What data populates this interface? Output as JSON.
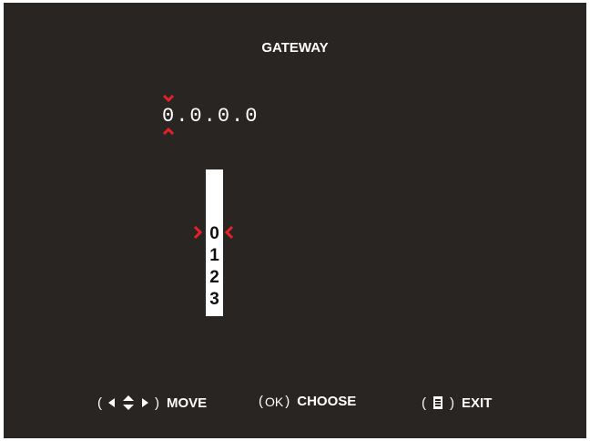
{
  "screen": {
    "title": "GATEWAY"
  },
  "ip_editor": {
    "octets": [
      "0",
      "0",
      "0",
      "0"
    ],
    "separator": ".",
    "active_octet_index": 0
  },
  "digit_picker": {
    "digits": [
      "0",
      "1",
      "2",
      "3"
    ],
    "selected_index": 0
  },
  "footer": {
    "move": {
      "open": "(",
      "close": ")",
      "label": "MOVE"
    },
    "choose": {
      "open": "(",
      "key": "OK",
      "close": ")",
      "label": "CHOOSE"
    },
    "exit": {
      "open": "(",
      "close": ")",
      "label": "EXIT"
    }
  },
  "colors": {
    "background": "#282522",
    "text": "#ffffff",
    "accent": "#e8202a"
  },
  "icons": {
    "caret_down": "chevron-down-icon",
    "caret_up": "chevron-up-icon",
    "arrows": "arrow-keys-icon",
    "menu": "menu-icon"
  }
}
